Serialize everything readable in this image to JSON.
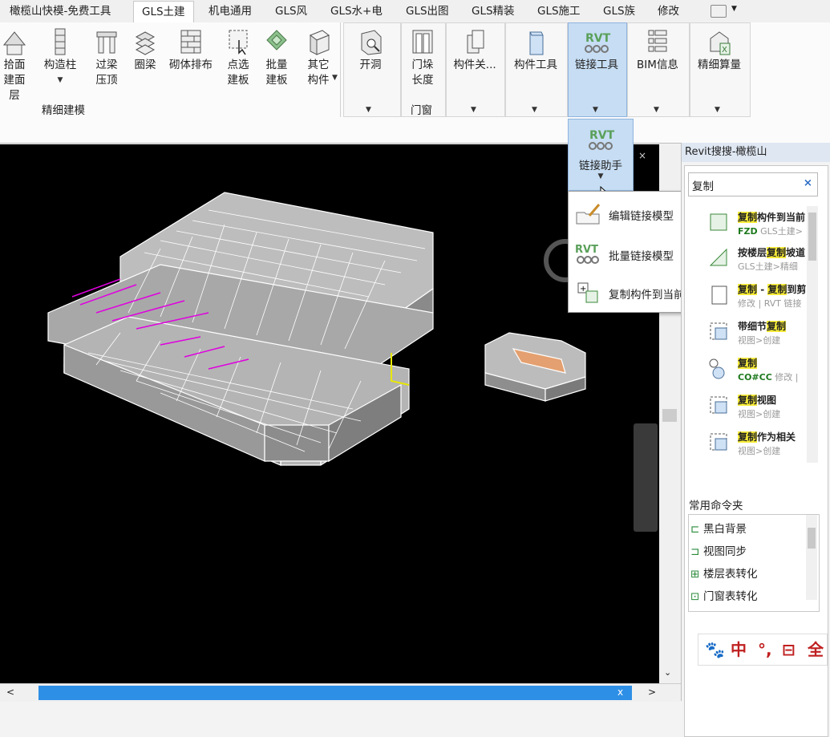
{
  "tabs": [
    {
      "label": "橄榄山快模-免费工具"
    },
    {
      "label": "GLS土建"
    },
    {
      "label": "机电通用"
    },
    {
      "label": "GLS风"
    },
    {
      "label": "GLS水+电"
    },
    {
      "label": "GLS出图"
    },
    {
      "label": "GLS精装"
    },
    {
      "label": "GLS施工"
    },
    {
      "label": "GLS族"
    },
    {
      "label": "修改"
    }
  ],
  "ribbon": {
    "btn_roof_1": "拾面",
    "btn_roof_2": "建面层",
    "btn_column_1": "构造柱",
    "btn_lintel_1": "过梁",
    "btn_lintel_2": "压顶",
    "btn_ringbeam": "圈梁",
    "btn_masonry": "砌体排布",
    "btn_pointslab_1": "点选",
    "btn_pointslab_2": "建板",
    "btn_batchslab_1": "批量",
    "btn_batchslab_2": "建板",
    "btn_other_1": "其它",
    "btn_other_2": "构件",
    "group_fine_model": "精细建模",
    "btn_opening": "开洞",
    "btn_door_1": "门垛",
    "btn_door_2": "长度",
    "group_door_window": "门窗",
    "btn_component_rel": "构件关...",
    "btn_component_tool": "构件工具",
    "btn_link_tool": "链接工具",
    "btn_bim_info": "BIM信息",
    "btn_fine_calc": "精细算量"
  },
  "dropdown": {
    "header": "链接助手",
    "rvt": "RVT",
    "items": [
      {
        "label": "编辑链接模型"
      },
      {
        "label": "批量链接模型"
      },
      {
        "label": "复制构件到当前模型"
      }
    ]
  },
  "side_panel": {
    "title": "Revit搜搜-橄榄山",
    "search_value": "复制",
    "search_clear": "×",
    "results": [
      {
        "t1_hl": "复制",
        "t1": "构件到当前",
        "t2_hl": "FZD",
        "t2": " GLS土建>"
      },
      {
        "t1_pre": "按楼层",
        "t1_hl": "复制",
        "t1": "坡道",
        "t2": "GLS土建>精细"
      },
      {
        "t1_hl": "复制",
        "t1": " - ",
        "t1_hl2": "复制",
        "t1_post": "到剪",
        "t2": "修改 | RVT 链接"
      },
      {
        "t1_pre": "带细节",
        "t1_hl": "复制",
        "t1": "",
        "t2": "视图>创建"
      },
      {
        "t1_hl": "复制",
        "t1": "",
        "t2_hl": "CO#CC",
        "t2": " 修改 |"
      },
      {
        "t1_hl": "复制",
        "t1": "视图",
        "t2": "视图>创建"
      },
      {
        "t1_hl": "复制",
        "t1": "作为相关",
        "t2": "视图>创建"
      }
    ],
    "common_label": "常用命令夹",
    "common_items": [
      {
        "label": "黑白背景"
      },
      {
        "label": "视图同步"
      },
      {
        "label": "楼层表转化"
      },
      {
        "label": "门窗表转化"
      }
    ]
  },
  "ime": {
    "items": [
      "中",
      "°,",
      "全"
    ]
  },
  "colors": {
    "accent": "#c6ddf3",
    "scroll_thumb": "#2e8fe6",
    "highlight": "#f7ec38",
    "rvt_green": "#5aa05a"
  }
}
